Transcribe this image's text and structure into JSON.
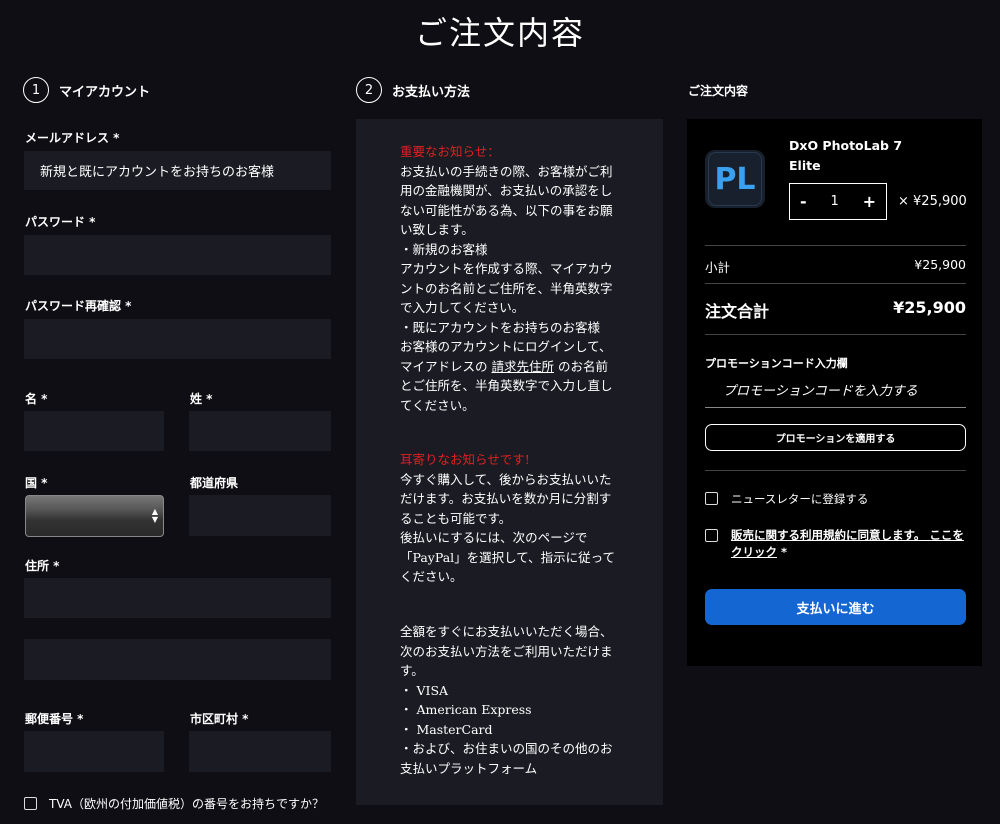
{
  "page_title": "ご注文内容",
  "account": {
    "step_number": "1",
    "heading": "マイアカウント",
    "email_label": "メールアドレス *",
    "email_placeholder": "新規と既にアカウントをお持ちのお客様",
    "password_label": "パスワード *",
    "password_confirm_label": "パスワード再確認 *",
    "first_name_label": "名 *",
    "last_name_label": "姓 *",
    "country_label": "国 *",
    "prefecture_label": "都道府県",
    "address_label": "住所 *",
    "postal_label": "郵便番号 *",
    "city_label": "市区町村 *",
    "tva_label": "TVA（欧州の付加価値税）の番号をお持ちですか？"
  },
  "payment": {
    "step_number": "2",
    "heading": "お支払い方法",
    "notice1_title": "重要なお知らせ：",
    "notice1_lines": [
      "お支払いの手続きの際、お客様がご利",
      "用の金融機関が、お支払いの承認をし",
      "ない可能性がある為、以下の事をお願",
      "い致します。",
      "・新規のお客様",
      "アカウントを作成する際、マイアカウ",
      "ントのお名前とご住所を、半角英数字",
      "で入力してください。",
      "・既にアカウントをお持ちのお客様",
      "お客様のアカウントにログインして、"
    ],
    "notice1_line_pre": "マイアドレスの ",
    "notice1_link": "請求先住所",
    "notice1_line_post": " のお名前",
    "notice1_lines_end": [
      "とご住所を、半角英数字で入力し直し",
      "てください。"
    ],
    "notice2_title": "耳寄りなお知らせです!",
    "notice2_lines": [
      "今すぐ購入して、後からお支払いいた",
      "だけます。お支払いを数か月に分割す",
      "ることも可能です。",
      "後払いにするには、次のページで",
      "「PayPal」を選択して、指示に従って",
      "ください。"
    ],
    "notice3_lines": [
      "全額をすぐにお支払いいただく場合、",
      "次のお支払い方法をご利用いただけま",
      "す。",
      "・ VISA",
      "・ American Express",
      "・ MasterCard",
      "・および、お住まいの国のその他のお",
      "支払いプラットフォーム"
    ]
  },
  "order": {
    "heading": "ご注文内容",
    "logo_text": "PL",
    "product_name_line1": "DxO PhotoLab 7",
    "product_name_line2": "Elite",
    "qty_minus": "-",
    "qty_value": "1",
    "qty_plus": "+",
    "unit_price": "× ¥25,900",
    "subtotal_label": "小計",
    "subtotal_value": "¥25,900",
    "total_label": "注文合計",
    "total_value": "¥25,900",
    "promo_label": "プロモーションコード入力欄",
    "promo_placeholder": "プロモーションコードを入力する",
    "promo_button": "プロモーションを適用する",
    "newsletter_label": "ニュースレターに登録する",
    "terms_line1": "販売に関する利用規約に同意します。 ここを",
    "terms_line2": "クリック",
    "terms_required": " *",
    "pay_button": "支払いに進む"
  },
  "colors": {
    "background": "#0e0e14",
    "field": "#1a1b23",
    "accent_blue": "#1466d3",
    "notice_red": "#e02020"
  }
}
